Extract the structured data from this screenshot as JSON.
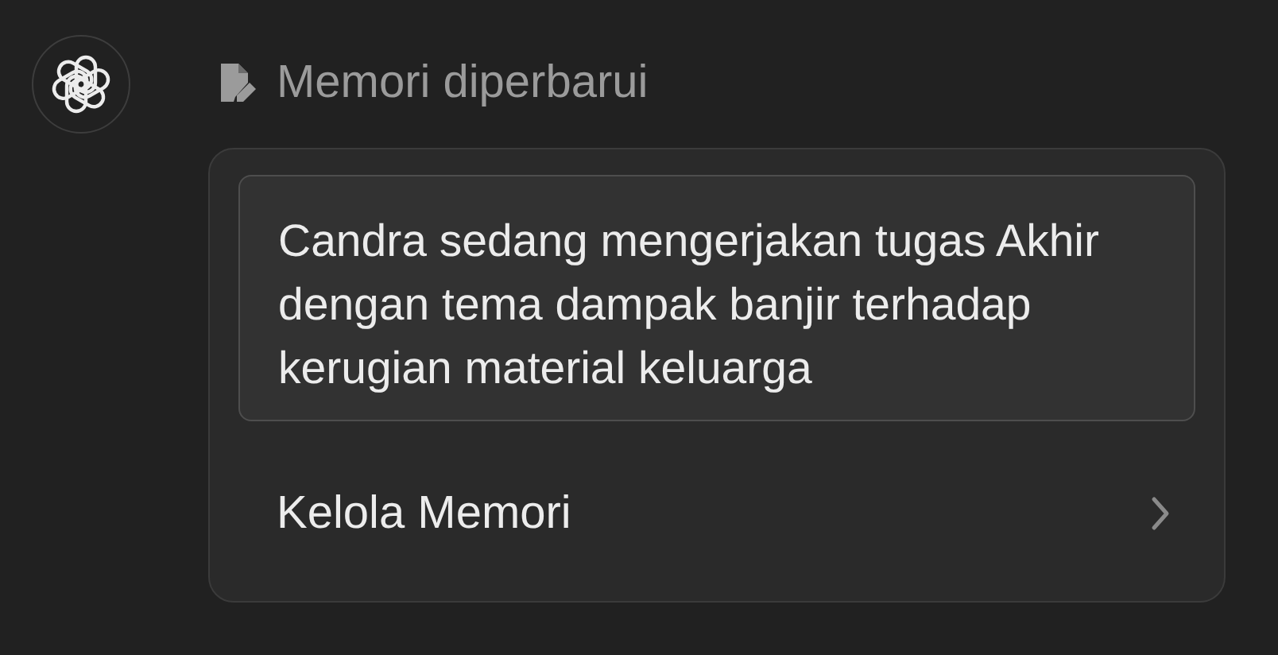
{
  "status": {
    "title": "Memori diperbarui"
  },
  "memory": {
    "text": "Candra sedang mengerjakan tugas Akhir dengan tema dampak banjir terhadap kerugian material keluarga"
  },
  "action": {
    "label": "Kelola Memori"
  }
}
